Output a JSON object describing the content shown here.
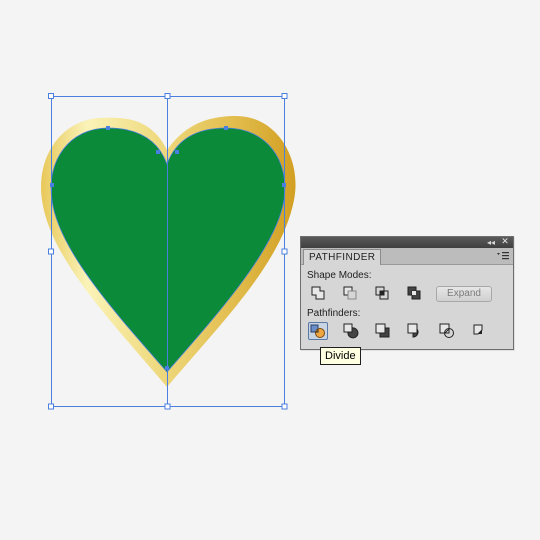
{
  "pathfinder_panel": {
    "title": "PATHFINDER",
    "collapse_glyph": "◂◂",
    "close_glyph": "✕",
    "menu_icon": "panel-menu-icon",
    "shape_modes_label": "Shape Modes:",
    "pathfinders_label": "Pathfinders:",
    "expand_label": "Expand",
    "shape_modes": [
      "unite-icon",
      "minus-front-icon",
      "intersect-icon",
      "exclude-icon"
    ],
    "pathfinders": [
      "divide-icon",
      "trim-icon",
      "merge-icon",
      "crop-icon",
      "outline-icon",
      "minus-back-icon"
    ],
    "active_pathfinder": "Divide"
  },
  "tooltip": {
    "text": "Divide"
  },
  "artwork": {
    "heart_fill": "#0b8a3a",
    "heart_outline_colors": [
      "#f7f2b2",
      "#d9ae36"
    ],
    "selection_color": "#4a7fe0"
  }
}
